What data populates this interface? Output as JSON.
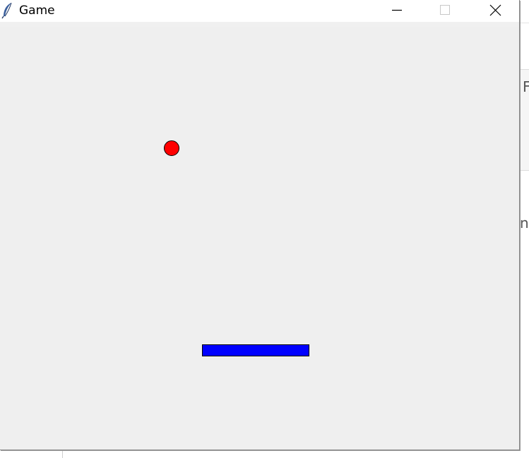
{
  "window": {
    "title": "Game",
    "app_icon": "feather-icon"
  },
  "controls": {
    "minimize_icon": "minimize-icon",
    "maximize_icon": "maximize-icon",
    "close_icon": "close-icon"
  },
  "game": {
    "ball_color": "#ff0000",
    "paddle_color": "#0000ff",
    "canvas_color": "#efefef"
  },
  "background_app": {
    "partial_text_1": "F",
    "partial_text_2": "n"
  }
}
